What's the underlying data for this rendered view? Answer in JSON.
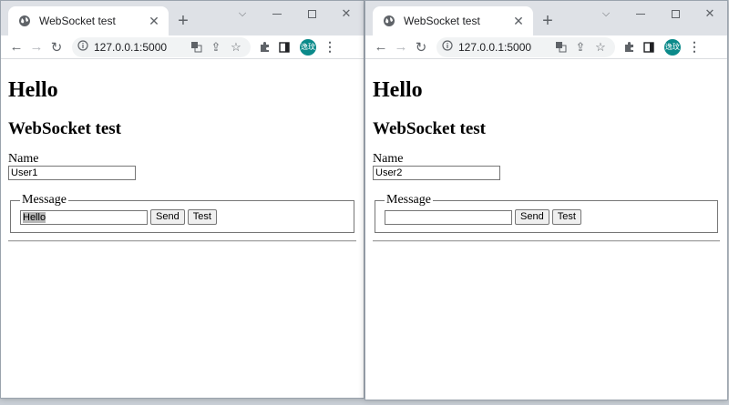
{
  "left": {
    "tab": {
      "title": "WebSocket test",
      "favicon": "globe-icon"
    },
    "url": "127.0.0.1:5000",
    "avatar": "逸玟",
    "page": {
      "heading": "Hello",
      "subheading": "WebSocket test",
      "name_label": "Name",
      "name_value": "User1",
      "message_legend": "Message",
      "message_value": "Hello",
      "send_label": "Send",
      "test_label": "Test"
    }
  },
  "right": {
    "tab": {
      "title": "WebSocket test",
      "favicon": "globe-icon"
    },
    "url": "127.0.0.1:5000",
    "avatar": "逸玟",
    "page": {
      "heading": "Hello",
      "subheading": "WebSocket test",
      "name_label": "Name",
      "name_value": "User2",
      "message_legend": "Message",
      "message_value": "",
      "send_label": "Send",
      "test_label": "Test"
    }
  },
  "colors": {
    "tabstrip": "#dee1e6",
    "avatar": "#0b8a8a",
    "omnibox": "#f1f3f4"
  }
}
